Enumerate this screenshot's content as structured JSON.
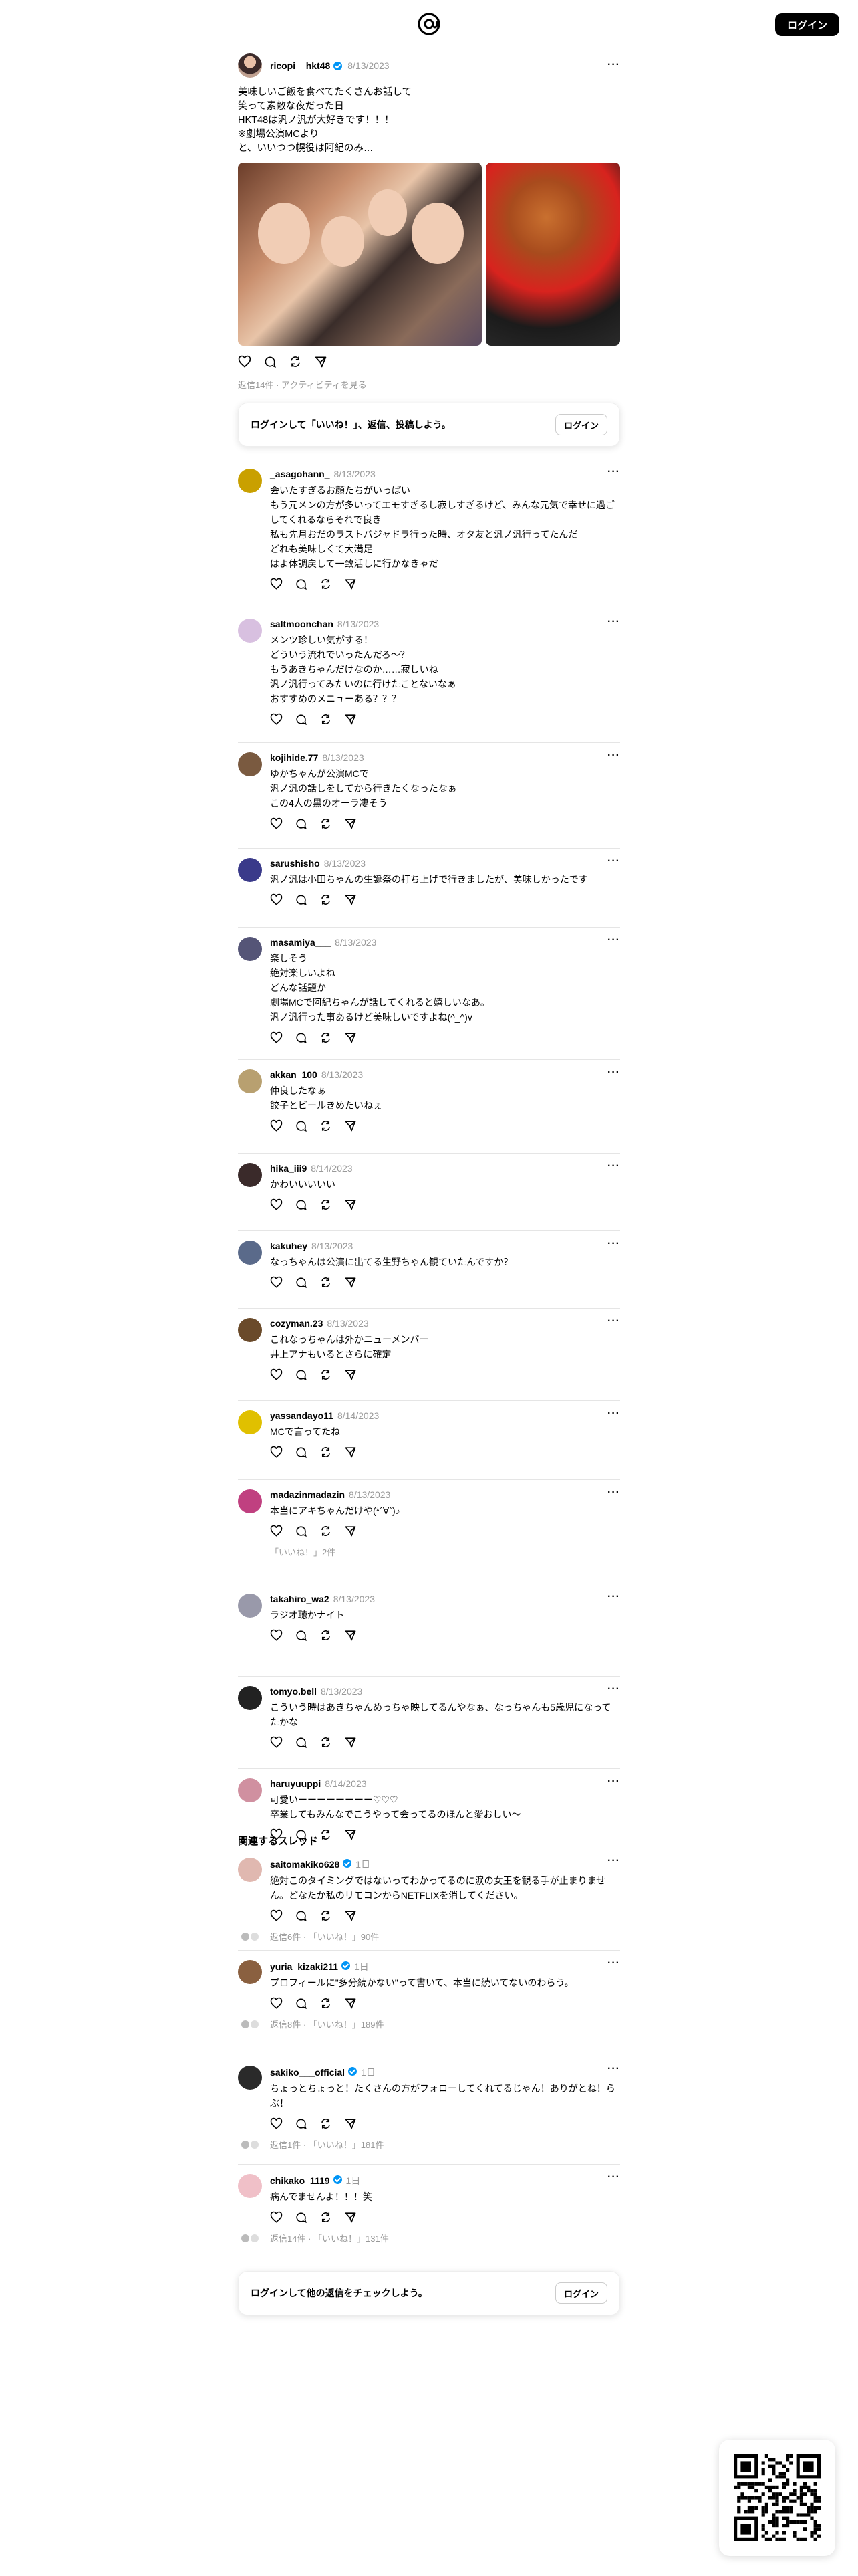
{
  "header": {
    "login_label": "ログイン"
  },
  "post": {
    "username": "ricopi__hkt48",
    "verified": true,
    "time": "8/13/2023",
    "more": "···",
    "text": "美味しいご飯を食べてたくさんお話して\n笑って素敵な夜だった日\nHKT48は汎ノ汎が大好きです！！！\n※劇場公演MCより\nと、いいつつ幌役は阿紀のみ…",
    "stats": "返信14件 · アクティビティを見る"
  },
  "login_card": {
    "text": "ログインして「いいね！」、返信、投稿しよう。",
    "button": "ログイン"
  },
  "replies": [
    {
      "name": "_asagohann_",
      "time": "8/13/2023",
      "text": [
        "会いたすぎるお顔たちがいっぱい",
        "もう元メンの方が多いってエモすぎるし寂しすぎるけど、みんな元気で幸せに過ごしてくれるならそれで良き",
        "私も先月おだのラストバジャドラ行った時、オタ友と汎ノ汎行ってたんだ",
        "どれも美味しくて大満足",
        "はよ体調戻して一致活しに行かなきゃだ"
      ],
      "likes": ""
    },
    {
      "name": "saltmoonchan",
      "time": "8/13/2023",
      "text": [
        "メンツ珍しい気がする！",
        "どういう流れでいったんだろ〜？",
        "もうあきちゃんだけなのか……寂しいね",
        "汎ノ汎行ってみたいのに行けたことないなぁ",
        "おすすめのメニューある？？？"
      ],
      "likes": ""
    },
    {
      "name": "kojihide.77",
      "time": "8/13/2023",
      "text": [
        "ゆかちゃんが公演MCで",
        "汎ノ汎の話しをしてから行きたくなったなぁ",
        "この4人の黒のオーラ凄そう"
      ],
      "likes": ""
    },
    {
      "name": "sarushisho",
      "time": "8/13/2023",
      "text": [
        "汎ノ汎は小田ちゃんの生誕祭の打ち上げで行きましたが、美味しかったです"
      ],
      "likes": ""
    },
    {
      "name": "masamiya___",
      "time": "8/13/2023",
      "text": [
        "楽しそう",
        "絶対楽しいよね",
        "どんな話題か",
        "劇場MCで阿紀ちゃんが話してくれると嬉しいなあ。",
        "汎ノ汎行った事あるけど美味しいですよね(^_^)v"
      ],
      "likes": ""
    },
    {
      "name": "akkan_100",
      "time": "8/13/2023",
      "text": [
        "仲良したなぁ",
        "餃子とビールきめたいねぇ"
      ],
      "likes": ""
    },
    {
      "name": "hika_iii9",
      "time": "8/14/2023",
      "text": [
        "かわいいいいい"
      ],
      "likes": ""
    },
    {
      "name": "kakuhey",
      "time": "8/13/2023",
      "text": [
        "なっちゃんは公演に出てる生野ちゃん観ていたんですか？"
      ],
      "likes": ""
    },
    {
      "name": "cozyman.23",
      "time": "8/13/2023",
      "text": [
        "これなっちゃんは外かニューメンバー",
        "井上アナもいるとさらに確定"
      ],
      "likes": ""
    },
    {
      "name": "yassandayo11",
      "time": "8/14/2023",
      "text": [
        "MCで言ってたね"
      ],
      "likes": ""
    },
    {
      "name": "madazinmadazin",
      "time": "8/13/2023",
      "text": [
        "本当にアキちゃんだけや(*´∀`)♪"
      ],
      "likes": "「いいね！」2件"
    },
    {
      "name": "takahiro_wa2",
      "time": "8/13/2023",
      "text": [
        "ラジオ聴かナイト"
      ],
      "likes": ""
    },
    {
      "name": "tomyo.bell",
      "time": "8/13/2023",
      "text": [
        "こういう時はあきちゃんめっちゃ映してるんやなぁ、なっちゃんも5歳児になってたかな"
      ],
      "likes": ""
    },
    {
      "name": "haruyuuppi",
      "time": "8/14/2023",
      "text": [
        "可愛いーーーーーーーー♡♡♡",
        "卒業してもみんなでこうやって会ってるのほんと愛おしい〜"
      ],
      "likes": ""
    }
  ],
  "related": {
    "title": "関連するスレッド",
    "threads": [
      {
        "name": "saitomakiko628",
        "verified": true,
        "time": "1日",
        "text": [
          "絶対このタイミングではないってわかってるのに涙の女王を観る手が止まりません。どなたか私のリモコンからNETFLIXを消してください。"
        ],
        "stats": "返信6件 · 「いいね！」90件"
      },
      {
        "name": "yuria_kizaki211",
        "verified": true,
        "time": "1日",
        "text": [
          "プロフィールに\"多分続かない\"って書いて、本当に続いてないのわらう。"
        ],
        "stats": "返信8件 · 「いいね！」189件"
      },
      {
        "name": "sakiko___official",
        "verified": true,
        "time": "1日",
        "text": [
          "ちょっとちょっと！たくさんの方がフォローしてくれてるじゃん！ありがとね！らぶ！"
        ],
        "stats": "返信1件 · 「いいね！」181件"
      },
      {
        "name": "chikako_1119",
        "verified": true,
        "time": "1日",
        "text": [
          "病んでませんよ！！！笑"
        ],
        "stats": "返信14件 · 「いいね！」131件"
      }
    ]
  },
  "bottom_card": {
    "text": "ログインして他の返信をチェックしよう。",
    "button": "ログイン"
  }
}
